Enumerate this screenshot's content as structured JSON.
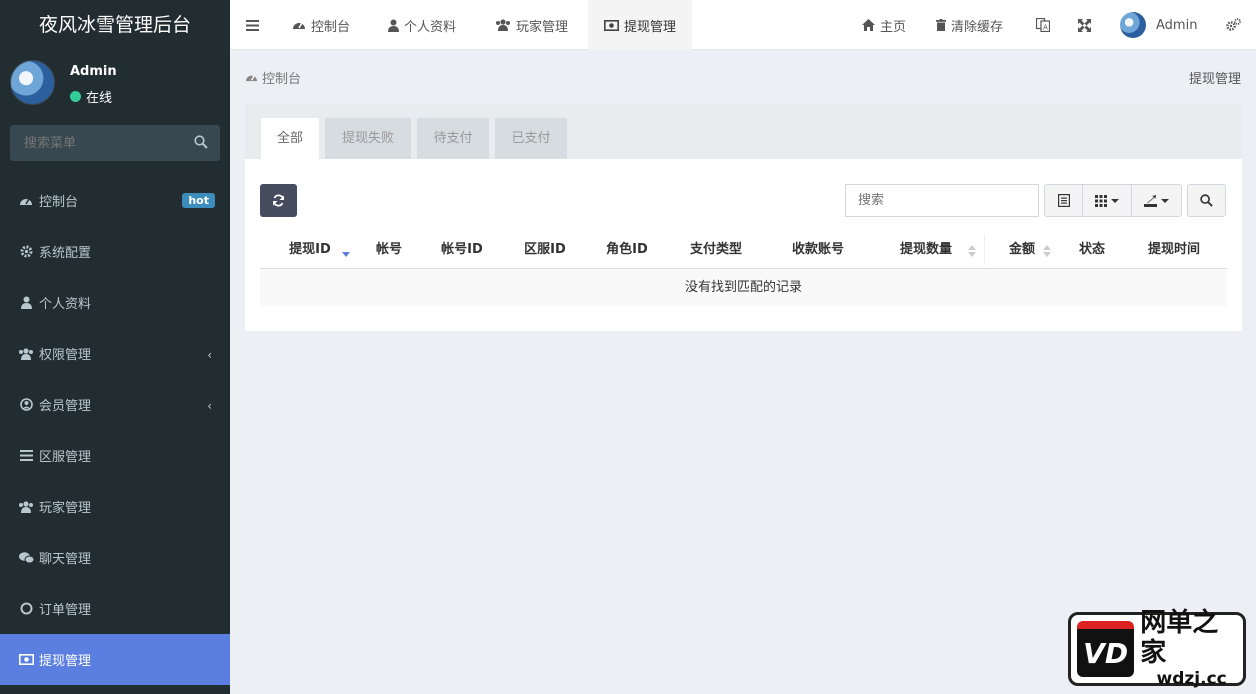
{
  "sidebar": {
    "brand": "夜风冰雪管理后台",
    "user": {
      "name": "Admin",
      "status": "在线"
    },
    "search_placeholder": "搜索菜单",
    "items": [
      {
        "label": "控制台",
        "icon": "dashboard-icon",
        "badge": "hot"
      },
      {
        "label": "系统配置",
        "icon": "gear-icon"
      },
      {
        "label": "个人资料",
        "icon": "user-icon"
      },
      {
        "label": "权限管理",
        "icon": "group-icon",
        "chevron": "‹"
      },
      {
        "label": "会员管理",
        "icon": "user-circle-icon",
        "chevron": "‹"
      },
      {
        "label": "区服管理",
        "icon": "list-icon"
      },
      {
        "label": "玩家管理",
        "icon": "group-icon"
      },
      {
        "label": "聊天管理",
        "icon": "chat-icon"
      },
      {
        "label": "订单管理",
        "icon": "circle-icon"
      },
      {
        "label": "提现管理",
        "icon": "money-icon",
        "active": true
      }
    ]
  },
  "navbar": {
    "tabs": [
      {
        "label": "控制台",
        "icon": "dashboard-icon"
      },
      {
        "label": "个人资料",
        "icon": "user-icon"
      },
      {
        "label": "玩家管理",
        "icon": "group-icon"
      },
      {
        "label": "提现管理",
        "icon": "money-icon",
        "active": true
      }
    ],
    "right": {
      "home": "主页",
      "clear_cache": "清除缓存",
      "user": "Admin"
    }
  },
  "breadcrumb": {
    "left": "控制台",
    "right": "提现管理"
  },
  "panel": {
    "tabs": [
      "全部",
      "提现失败",
      "待支付",
      "已支付"
    ],
    "search_placeholder": "搜索",
    "columns": [
      "提现ID",
      "帐号",
      "帐号ID",
      "区服ID",
      "角色ID",
      "支付类型",
      "收款账号",
      "提现数量",
      "金额",
      "状态",
      "提现时间"
    ],
    "empty_message": "没有找到匹配的记录"
  },
  "watermark": {
    "logo_text": "VD",
    "title": "网单之家",
    "domain": "wdzj.cc"
  },
  "colors": {
    "sidebar_bg": "#222d32",
    "active_menu": "#5b7fe0",
    "badge": "#3c8dbc",
    "status_online": "#33cc99"
  }
}
